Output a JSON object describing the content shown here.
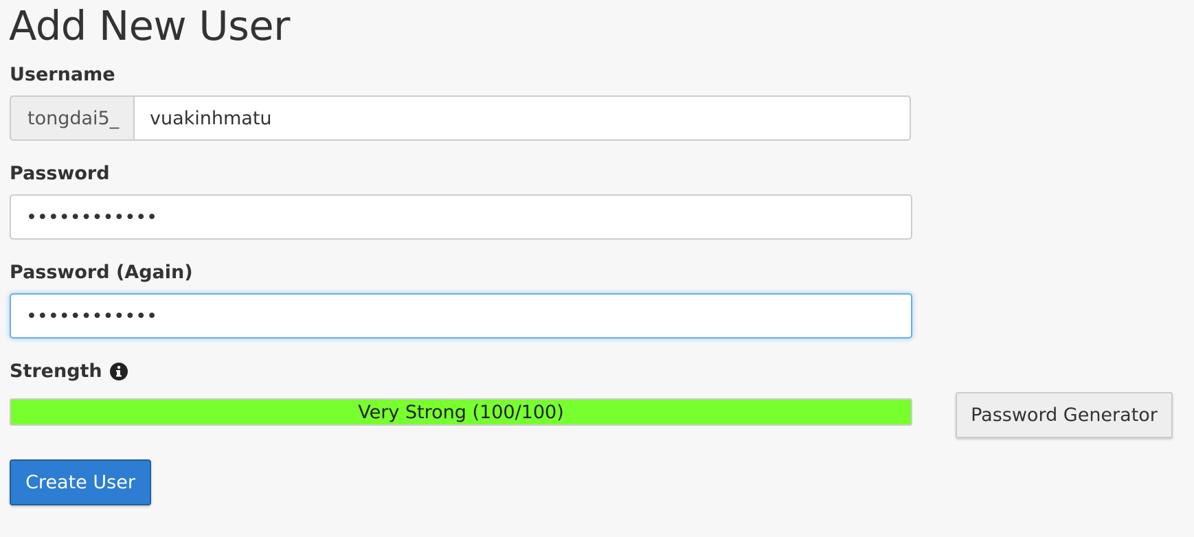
{
  "page": {
    "title": "Add New User"
  },
  "form": {
    "username": {
      "label": "Username",
      "prefix": "tongdai5_",
      "value": "vuakinhmatu"
    },
    "password": {
      "label": "Password",
      "value": "••••••••••••"
    },
    "password_again": {
      "label": "Password (Again)",
      "value": "••••••••••••"
    },
    "strength": {
      "label": "Strength",
      "info_icon": "info-circle-icon",
      "text": "Very Strong (100/100)",
      "score": 100,
      "max": 100,
      "bar_color": "#78ff2e"
    },
    "password_generator_label": "Password Generator",
    "create_user_label": "Create User"
  },
  "colors": {
    "primary_button": "#2d7dd2",
    "focus_border": "#66afe9",
    "background": "#f7f7f7"
  }
}
